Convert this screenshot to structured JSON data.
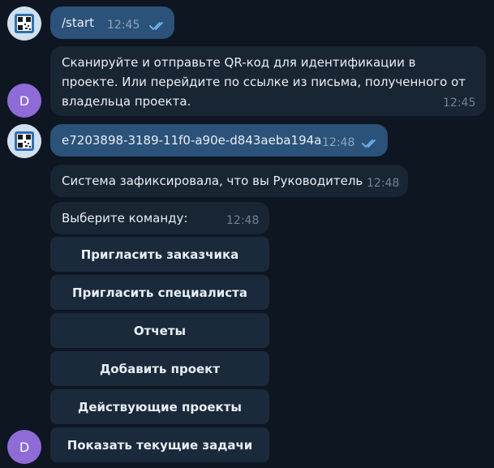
{
  "colors": {
    "background": "#0e1621",
    "outgoing": "#2b5278",
    "incoming": "#182533",
    "keyboard_button": "#1a2a3b",
    "avatar_d": "#8e6bd6"
  },
  "avatars": {
    "user_icon": "qr-avatar-icon",
    "bot_letter": "D"
  },
  "messages": [
    {
      "text": "/start",
      "time": "12:45",
      "status": "read"
    },
    {
      "text": "Сканируйте и отправьте QR-код для идентификации в проекте. Или перейдите по ссылке из письма, полученного от владельца проекта.",
      "time": "12:45"
    },
    {
      "text": "e7203898-3189-11f0-a90e-d843aeba194a",
      "time": "12:48",
      "status": "read"
    },
    {
      "text": "Система зафиксировала, что вы Руководитель",
      "time": "12:48"
    },
    {
      "text": "Выберите команду:",
      "time": "12:48"
    }
  ],
  "keyboard": [
    {
      "label": "Пригласить заказчика"
    },
    {
      "label": "Пригласить специалиста"
    },
    {
      "label": "Отчеты"
    },
    {
      "label": "Добавить проект"
    },
    {
      "label": "Действующие проекты"
    },
    {
      "label": "Показать текущие задачи"
    }
  ]
}
